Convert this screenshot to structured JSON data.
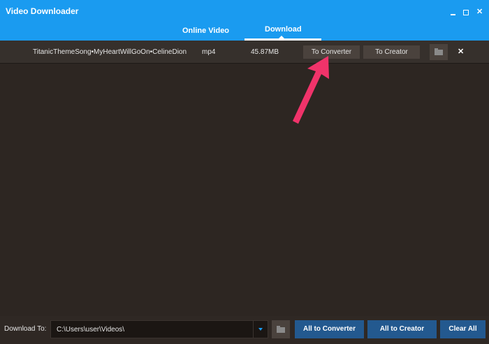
{
  "app": {
    "title": "Video Downloader"
  },
  "tabs": [
    {
      "label": "Online Video"
    },
    {
      "label": "Download"
    }
  ],
  "download_item": {
    "title": "TitanicThemeSong•MyHeartWillGoOn•CelineDion",
    "format": "mp4",
    "size": "45.87MB",
    "to_converter_label": "To Converter",
    "to_creator_label": "To Creator"
  },
  "footer": {
    "download_to_label": "Download To:",
    "path_value": "C:\\Users\\user\\Videos\\",
    "all_to_converter_label": "All to Converter",
    "all_to_creator_label": "All to Creator",
    "clear_all_label": "Clear All"
  },
  "colors": {
    "accent": "#1a9bf0",
    "background": "#2d2622",
    "button_primary": "#23598f",
    "annotation_arrow": "#f0336a"
  },
  "icons": [
    "minimize-icon",
    "maximize-icon",
    "close-icon",
    "folder-icon",
    "remove-icon",
    "dropdown-arrow-icon",
    "annotation-arrow"
  ]
}
